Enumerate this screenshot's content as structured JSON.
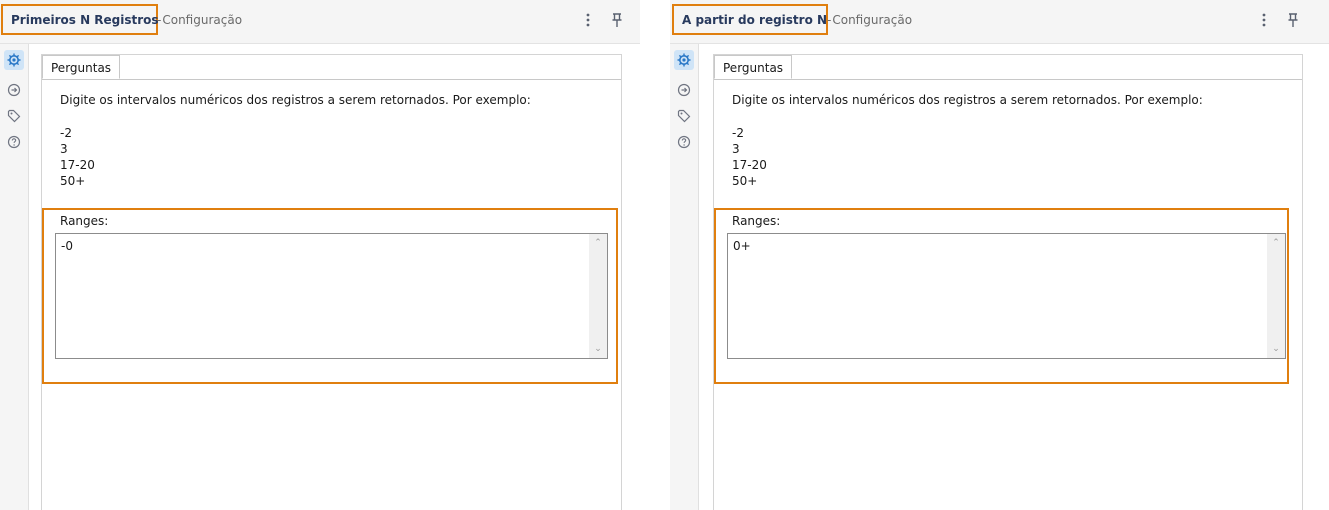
{
  "panels": [
    {
      "title": "Primeiros N Registros",
      "subtitle": "Configuração",
      "separator": "-",
      "tab_label": "Perguntas",
      "description": "Digite os intervalos numéricos dos registros a serem retornados.  Por exemplo:",
      "examples": [
        "-2",
        "3",
        "17-20",
        "50+"
      ],
      "ranges_label": "Ranges:",
      "ranges_value": "-0"
    },
    {
      "title": "A partir do registro N",
      "subtitle": "Configuração",
      "separator": "-",
      "tab_label": "Perguntas",
      "description": "Digite os intervalos numéricos dos registros a serem retornados.  Por exemplo:",
      "examples": [
        "-2",
        "3",
        "17-20",
        "50+"
      ],
      "ranges_label": "Ranges:",
      "ranges_value": "0+"
    }
  ],
  "header_icons": {
    "menu": "⋮",
    "pin": "📌"
  },
  "rail_icons": [
    {
      "name": "gear-icon",
      "glyph": "⚙"
    },
    {
      "name": "connections-icon",
      "glyph": "➜"
    },
    {
      "name": "tag-icon",
      "glyph": "⌘"
    },
    {
      "name": "help-icon",
      "glyph": "?"
    }
  ],
  "scroll_arrows": {
    "up": "⌃",
    "down": "⌄"
  },
  "colors": {
    "highlight": "#e07f0f",
    "title_text": "#283a5e",
    "active_rail": "#cfe4f7"
  }
}
